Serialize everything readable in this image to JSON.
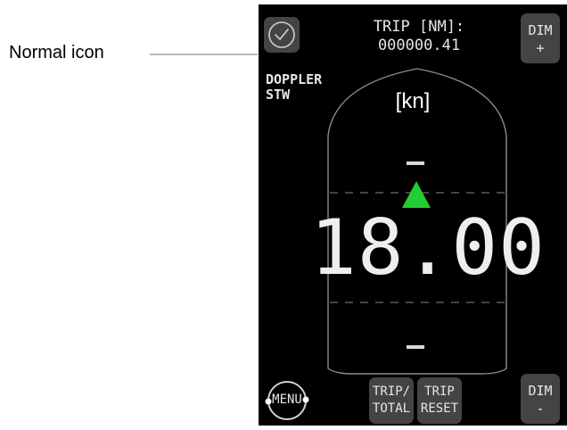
{
  "annotation": {
    "label": "Normal icon"
  },
  "header": {
    "trip_label": "TRIP [NM]:",
    "trip_value": "000000.41",
    "dim_plus_line1": "DIM",
    "dim_plus_line2": "+"
  },
  "mode": {
    "line1": "DOPPLER",
    "line2": "STW"
  },
  "display": {
    "unit": "[kn]",
    "speed": "18.00",
    "direction_indicator_color": "#22cc33"
  },
  "footer": {
    "menu_label": "MENU",
    "trip_total_line1": "TRIP/",
    "trip_total_line2": "TOTAL",
    "trip_reset_line1": "TRIP",
    "trip_reset_line2": "RESET",
    "dim_minus_line1": "DIM",
    "dim_minus_line2": "-"
  },
  "icons": {
    "status": "check-circle-icon",
    "direction": "triangle-up-icon"
  }
}
